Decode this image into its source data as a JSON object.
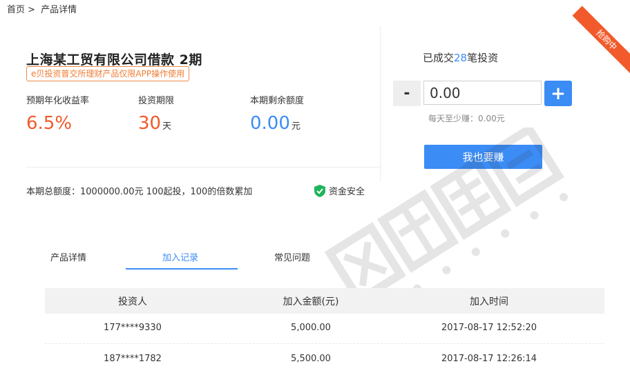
{
  "breadcrumb": {
    "home": "首页",
    "separator": ">",
    "current": "产品详情"
  },
  "product": {
    "title": "上海某工贸有限公司借款 2期",
    "tag": "e贝投资普交所理财产品仅限APP操作使用",
    "stats": [
      {
        "label": "预期年化收益率",
        "value": "6.5%",
        "unit": "",
        "color": "#f05a2b"
      },
      {
        "label": "投资期限",
        "value": "30",
        "unit": "天",
        "color": "#f05a2b"
      },
      {
        "label": "本期剩余额度",
        "value": "0.00",
        "unit": "元",
        "color": "#3b8cf5"
      }
    ],
    "total_note": "本期总额度：1000000.00元 100起投，100的倍数累加",
    "safety_label": "资金安全"
  },
  "invest": {
    "ribbon": "抢购中",
    "deal_prefix": "已成交",
    "deal_count": "28",
    "deal_suffix": "笔投资",
    "minus": "-",
    "plus": "+",
    "amount": "0.00",
    "daily_earn": "每天至少赚：0.00元",
    "button": "我也要赚"
  },
  "tabs": [
    {
      "label": "产品详情",
      "active": false
    },
    {
      "label": "加入记录",
      "active": true
    },
    {
      "label": "常见问题",
      "active": false
    }
  ],
  "records": {
    "headers": [
      "投资人",
      "加入金额(元)",
      "加入时间"
    ],
    "rows": [
      [
        "177****9330",
        "5,000.00",
        "2017-08-17 12:52:20"
      ],
      [
        "187****1782",
        "5,500.00",
        "2017-08-17 12:26:14"
      ]
    ]
  },
  "colors": {
    "accent_blue": "#3b8cf5",
    "accent_orange": "#f05a2b",
    "safe_green": "#1fb45a"
  }
}
